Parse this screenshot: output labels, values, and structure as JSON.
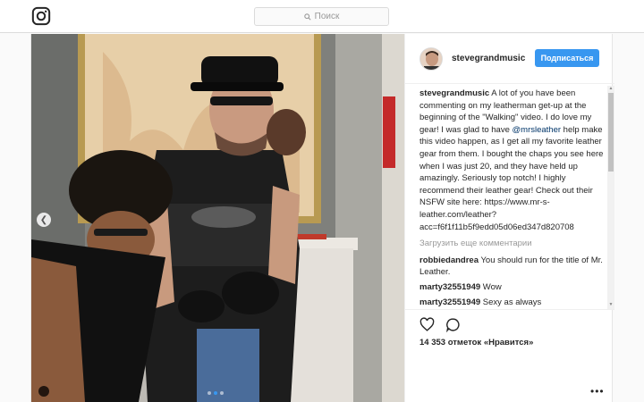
{
  "search": {
    "placeholder": "Поиск"
  },
  "post": {
    "author": "stevegrandmusic",
    "follow_label": "Подписаться",
    "caption_user": "stevegrandmusic",
    "caption_part1": " A lot of you have been commenting on my leatherman get-up at the beginning of the \"Walking\" video. I do love my gear! I was glad to have ",
    "caption_mention": "@mrsleather",
    "caption_part2": " help make this video happen, as I get all my favorite leather gear from them. I bought the chaps you see here when I was just 20, and they have held up amazingly. Seriously top notch! I highly recommend their leather gear! Check out their NSFW site here: https://www.mr-s-leather.com/leather?acc=f6f1f11b5f9edd05d06ed347d820708",
    "load_more": "Загрузить еще комментарии",
    "comments": [
      {
        "user": "robbiedandrea",
        "text": " You should run for the title of Mr. Leather."
      },
      {
        "user": "marty32551949",
        "text": " Wow"
      },
      {
        "user": "marty32551949",
        "text": " Sexy as always"
      }
    ],
    "likes": "14 353 отметок «Нравится»",
    "more_label": "•••"
  },
  "icons": {
    "logo": "instagram-logo-icon",
    "search": "search-icon",
    "like": "heart-icon",
    "comment": "comment-bubble-icon",
    "prev": "chevron-left-icon",
    "tag": "user-tag-icon"
  },
  "colors": {
    "accent": "#3897f0",
    "border": "#dbdbdb"
  }
}
